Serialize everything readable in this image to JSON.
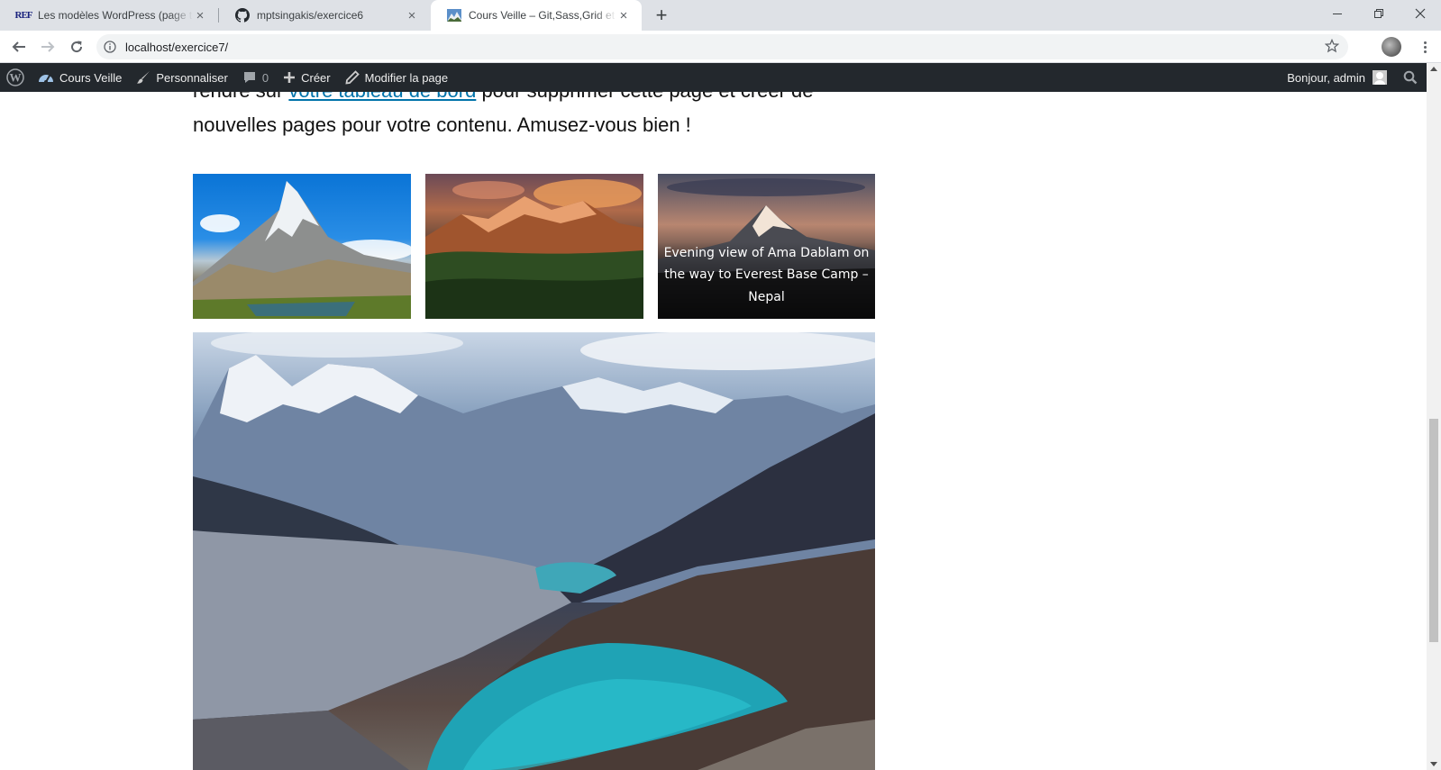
{
  "browser": {
    "tabs": [
      {
        "icon": "ref-favicon-icon",
        "title": "Les modèles WordPress (page te",
        "close": "×"
      },
      {
        "icon": "github-icon",
        "title": "mptsingakis/exercice6",
        "close": "×"
      },
      {
        "icon": "mountain-favicon-icon",
        "title": "Cours Veille – Git,Sass,Grid et Th",
        "close": "×",
        "active": true
      }
    ],
    "favicon_ref_text": "REF",
    "new_tab_label": "+",
    "address": "localhost/exercice7/"
  },
  "adminbar": {
    "site_name": "Cours Veille",
    "customize": "Personnaliser",
    "comments_count": "0",
    "new": "Créer",
    "edit_page": "Modifier la page",
    "greeting": "Bonjour, admin"
  },
  "content": {
    "para_line1_before": "rendre sur ",
    "para_link": "votre tableau de bord",
    "para_line1_after": " pour supprimer cette page et créer de",
    "para_line2": "nouvelles pages pour votre contenu. Amusez-vous bien !",
    "gallery_caption": "Evening view of Ama Dablam on the way to Everest Base Camp – Nepal"
  },
  "colors": {
    "adminbar_bg": "#23282d",
    "link": "#0073aa",
    "tabstrip_bg": "#dee1e6"
  }
}
